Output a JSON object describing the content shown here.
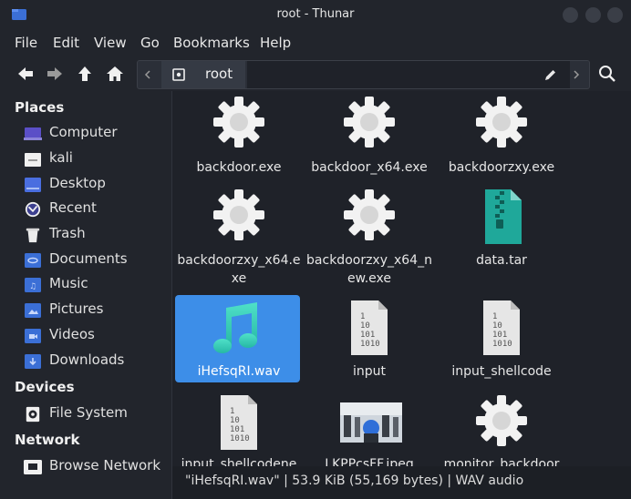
{
  "window": {
    "title": "root - Thunar"
  },
  "menu": [
    "File",
    "Edit",
    "View",
    "Go",
    "Bookmarks",
    "Help"
  ],
  "path": {
    "current": "root"
  },
  "sidebar": {
    "places_heading": "Places",
    "places": [
      "Computer",
      "kali",
      "Desktop",
      "Recent",
      "Trash",
      "Documents",
      "Music",
      "Pictures",
      "Videos",
      "Downloads"
    ],
    "devices_heading": "Devices",
    "devices": [
      "File System"
    ],
    "network_heading": "Network",
    "network": [
      "Browse Network"
    ]
  },
  "files": [
    {
      "name": "backdoor.exe",
      "icon": "gear-icon"
    },
    {
      "name": "backdoor_x64.exe",
      "icon": "gear-icon"
    },
    {
      "name": "backdoorzxy.exe",
      "icon": "gear-icon"
    },
    {
      "name": "backdoorzxy_x64.e\nxe",
      "icon": "gear-icon"
    },
    {
      "name": "backdoorzxy_x64_n\new.exe",
      "icon": "gear-icon"
    },
    {
      "name": "data.tar",
      "icon": "archive-icon"
    },
    {
      "name": "iHefsqRI.wav",
      "icon": "music-note-icon"
    },
    {
      "name": "input",
      "icon": "binary-file-icon"
    },
    {
      "name": "input_shellcode",
      "icon": "binary-file-icon"
    },
    {
      "name": "input_shellcodene",
      "icon": "binary-file-icon"
    },
    {
      "name": "LKPPcsFF.jpeg",
      "icon": "image-thumbnail"
    },
    {
      "name": "monitor_backdoor",
      "icon": "gear-icon"
    }
  ],
  "status": "\"iHefsqRI.wav\" | 53.9 KiB (55,169 bytes) | WAV audio",
  "colors": {
    "accent": "#3d8ee8",
    "folder": "#3b6fd6",
    "window_bg": "#1f2229"
  }
}
